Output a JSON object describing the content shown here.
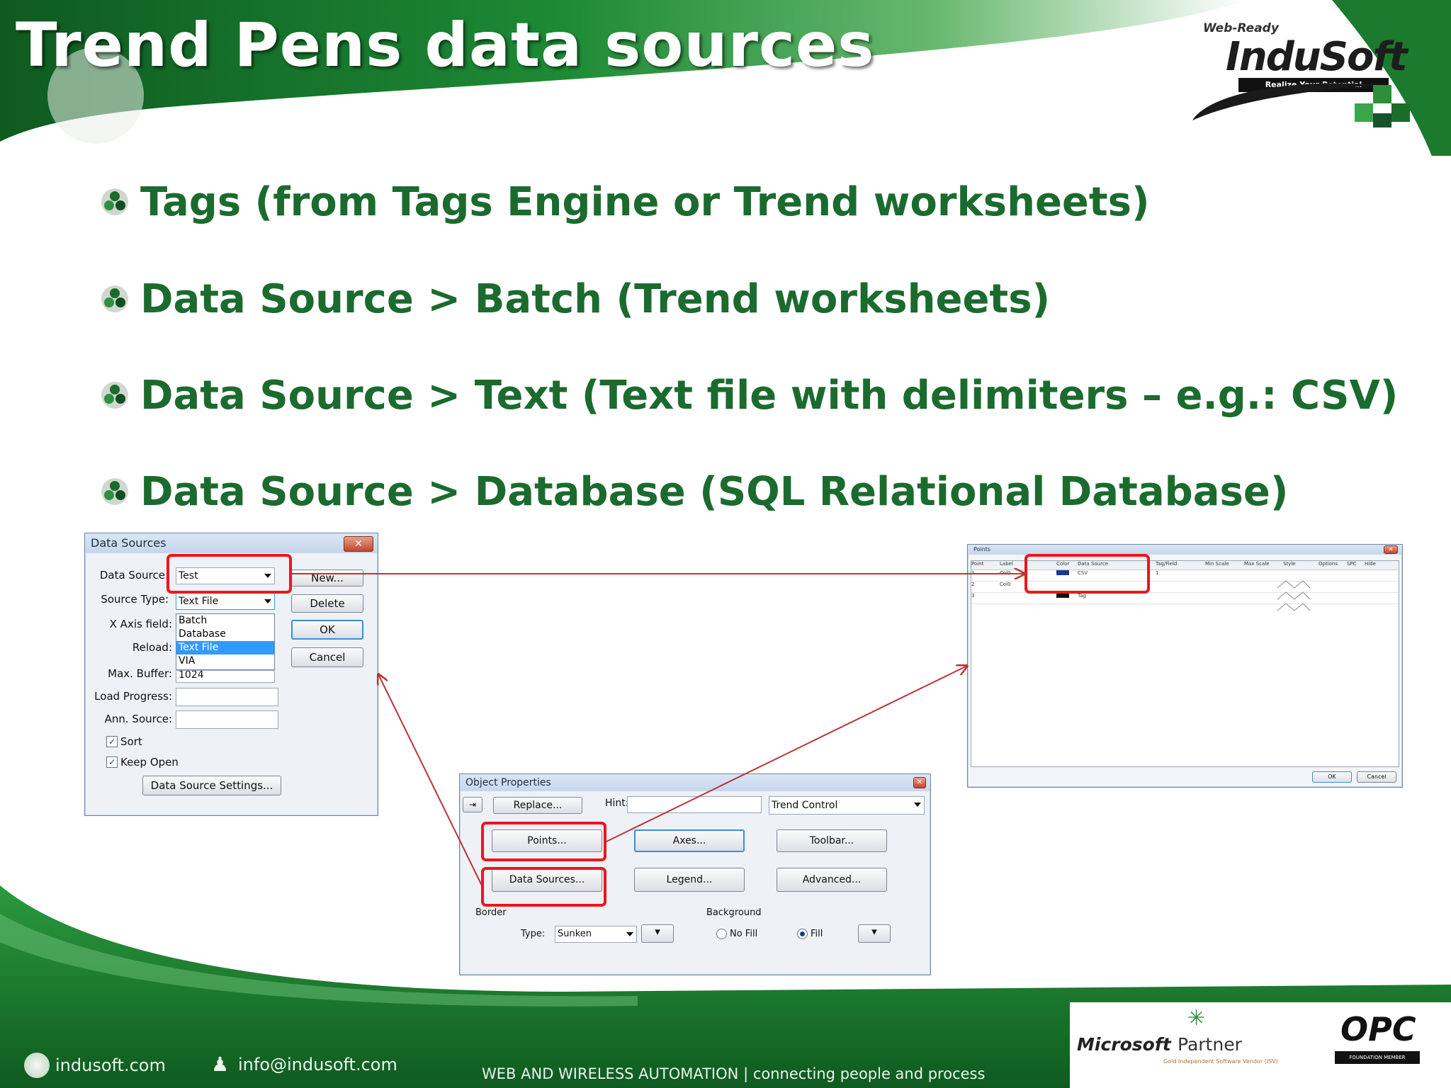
{
  "slide": {
    "title": "Trend Pens data sources",
    "logo": {
      "tag": "Web-Ready",
      "word": "InduSoft",
      "slogan": "Realize Your Potential"
    }
  },
  "bullets": [
    "Tags (from Tags Engine or Trend worksheets)",
    "Data Source > Batch (Trend worksheets)",
    "Data Source > Text (Text file with delimiters – e.g.: CSV)",
    "Data Source > Database (SQL Relational Database)"
  ],
  "data_sources_dialog": {
    "title": "Data Sources",
    "close": "✕",
    "labels": {
      "data_source": "Data Source:",
      "source_type": "Source Type:",
      "x_axis": "X Axis field:",
      "reload": "Reload:",
      "max_buffer": "Max. Buffer:",
      "load_progress": "Load Progress:",
      "ann_source": "Ann. Source:"
    },
    "values": {
      "data_source": "Test",
      "source_type": "Text File",
      "max_buffer": "1024",
      "load_progress": "",
      "ann_source": ""
    },
    "dropdown_options": [
      "Batch",
      "Database",
      "Text File",
      "VIA"
    ],
    "dropdown_selected": "Text File",
    "buttons": {
      "new": "New...",
      "delete": "Delete",
      "ok": "OK",
      "cancel": "Cancel",
      "settings": "Data Source Settings..."
    },
    "checkboxes": [
      {
        "label": "Sort",
        "checked": true
      },
      {
        "label": "Keep Open",
        "checked": true
      }
    ]
  },
  "points_dialog": {
    "title": "Points",
    "columns": [
      "Point",
      "Label",
      "Color",
      "Data Source",
      "Tag/Field",
      "Min Scale",
      "Max Scale",
      "Style",
      "Options",
      "SPC",
      "Hide"
    ],
    "rows": [
      {
        "n": "1",
        "label": "Col0",
        "source": "CSV",
        "tag": "1"
      },
      {
        "n": "2",
        "label": "Col0",
        "source": "",
        "tag": ""
      },
      {
        "n": "3",
        "label": "",
        "source": "Tag",
        "tag": ""
      }
    ],
    "buttons": {
      "ok": "OK",
      "cancel": "Cancel"
    }
  },
  "object_properties": {
    "title": "Object Properties",
    "replace": "Replace...",
    "hint_label": "Hint:",
    "hint_value": "",
    "object_type": "Trend Control",
    "buttons": {
      "points": "Points...",
      "axes": "Axes...",
      "toolbar": "Toolbar...",
      "data_sources": "Data Sources...",
      "legend": "Legend...",
      "advanced": "Advanced..."
    },
    "border_label": "Border",
    "type_label": "Type:",
    "type_value": "Sunken",
    "background_label": "Background",
    "no_fill": "No Fill",
    "fill": "Fill",
    "fill_selected": true
  },
  "footer": {
    "website": "indusoft.com",
    "email": "info@indusoft.com",
    "tagline_left": "WEB AND WIRELESS AUTOMATION",
    "tagline_sep": "|",
    "tagline_right": "connecting people and process",
    "ms_partner_brand": "Microsoft",
    "ms_partner_word": "Partner",
    "ms_partner_sub": "Gold Independent Software Vendor (ISV)",
    "opc": "OPC",
    "opc_sub": "FOUNDATION MEMBER"
  },
  "colors": {
    "brand_green": "#1b7a2e",
    "bullet_text": "#1b6b2e",
    "highlight_red": "#f0141b",
    "connector_red": "#b8343a"
  }
}
